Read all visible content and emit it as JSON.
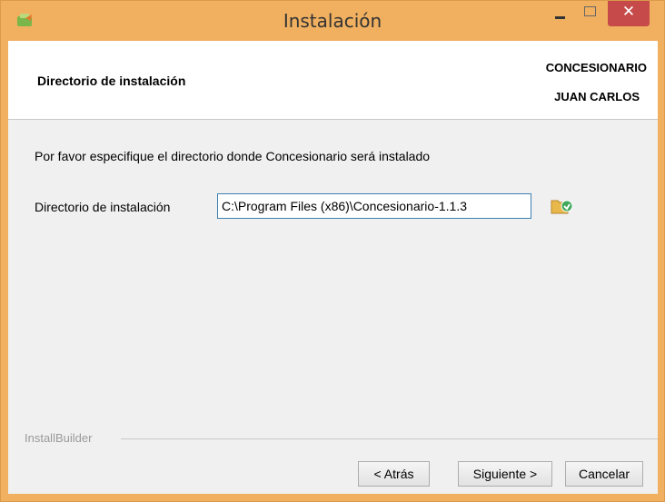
{
  "window": {
    "title": "Instalación",
    "controls": {
      "minimize_icon": "minimize-icon",
      "maximize_icon": "maximize-icon",
      "close_label": "✕"
    }
  },
  "header": {
    "title": "Directorio de instalación",
    "brand_line1": "CONCESIONARIO",
    "brand_line2": "JUAN CARLOS"
  },
  "main": {
    "instruction": "Por favor especifique el directorio donde Concesionario será instalado",
    "directory_label": "Directorio de instalación",
    "directory_value": "C:\\Program Files (x86)\\Concesionario-1.1.3",
    "browse_icon": "folder-browse-icon"
  },
  "footer": {
    "installbuilder_label": "InstallBuilder",
    "back_label": "< Atrás",
    "next_label": "Siguiente >",
    "cancel_label": "Cancelar"
  },
  "colors": {
    "title_bar": "#f0b060",
    "close_button": "#c74a4a",
    "input_border": "#3c7fb1"
  }
}
